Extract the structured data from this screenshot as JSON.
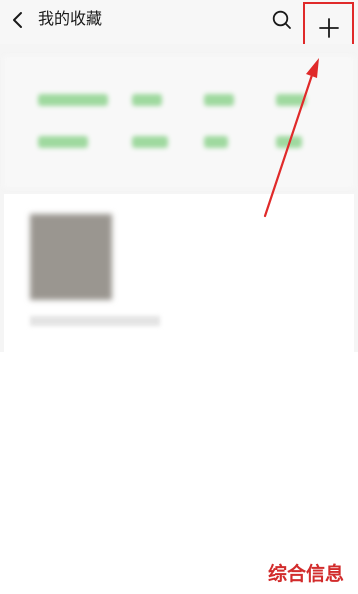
{
  "header": {
    "title": "我的收藏",
    "back_icon": "chevron-left-icon",
    "search_icon": "search-icon",
    "add_icon": "plus-icon"
  },
  "annotation": {
    "box_color": "#e02a2a",
    "arrow_color": "#e02a2a"
  },
  "watermark": {
    "text": "综合信息",
    "color": "#d22c2c"
  }
}
